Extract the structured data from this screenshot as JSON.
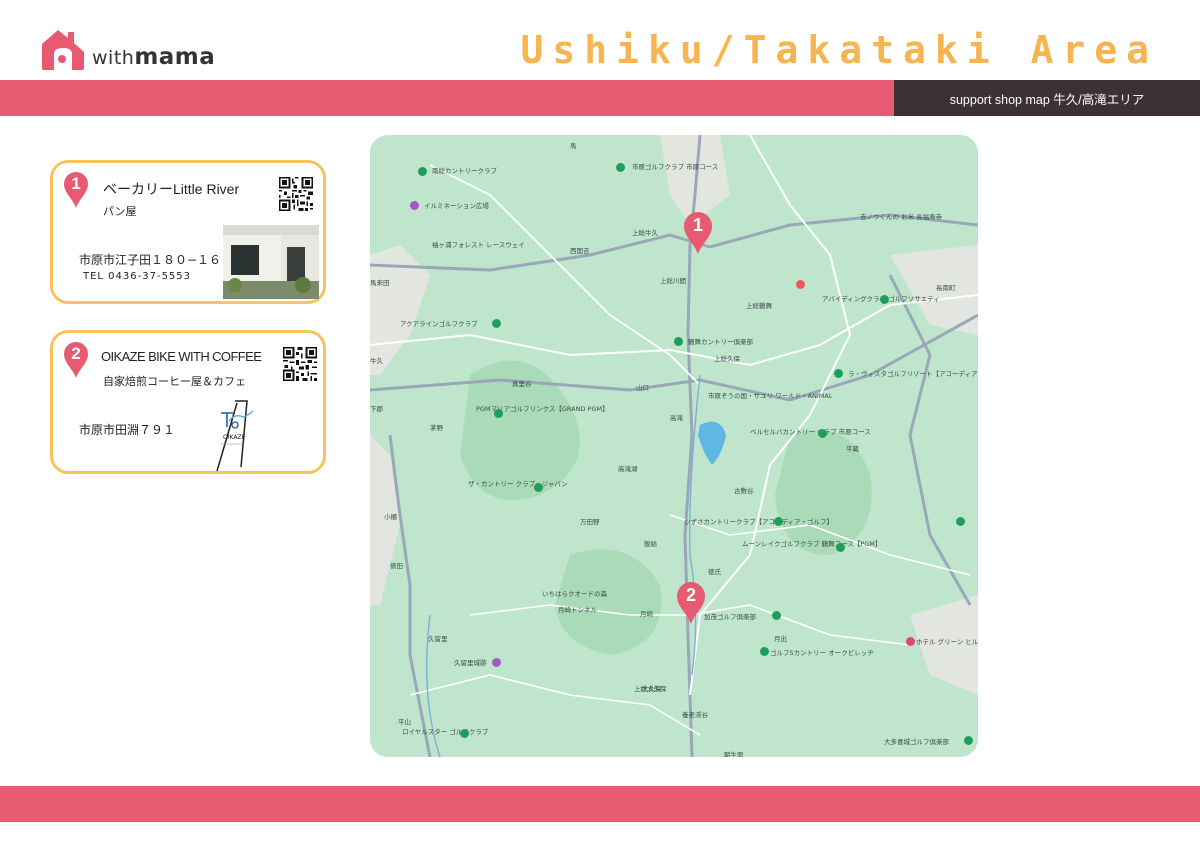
{
  "brand": {
    "logo_with": "with",
    "logo_mama": "mama"
  },
  "header": {
    "area_title": "Ushiku/Takataki  Area",
    "subtitle": "support shop map 牛久/高滝エリア"
  },
  "colors": {
    "accent_pink": "#e85a71",
    "accent_orange": "#f7b451",
    "dark": "#3c3233",
    "card_border": "#f6c35e"
  },
  "shops": [
    {
      "number": "1",
      "name": "ベーカリーLittle River",
      "type": "パン屋",
      "address": "市原市江子田１８０−１６",
      "tel": "TEL 0436-37-5553",
      "has_qr": true,
      "image": "shop-photo"
    },
    {
      "number": "2",
      "name": "OIKAZE BIKE WITH COFFEE",
      "type": "自家焙煎コーヒー屋＆カフェ",
      "address": "市原市田淵７９１",
      "has_qr": true,
      "image": "oikaze-logo",
      "logo_text": "OIKAZE"
    }
  ],
  "map": {
    "markers": [
      {
        "number": "1"
      },
      {
        "number": "2"
      }
    ],
    "labels": [
      "南総カントリークラブ",
      "市原ゴルフクラブ 市原コース",
      "イルミネーション広場",
      "袖ヶ浦フォレスト レースウェイ",
      "アクアラインゴルフクラブ",
      "PGMマリアゴルフリンクス【GRAND PGM】",
      "ザ・カントリー クラブ・ジャパン",
      "鶴舞カントリー倶楽部",
      "上総久保",
      "アバイディングクラブ ゴルフソサエティ",
      "長南町",
      "吉ノウくんの お米 長福寿寺",
      "ラ・ヴィスタゴルフリゾート【アコーディア・ゴルフ】",
      "ベルセルバカントリー クラブ 市原コース",
      "かずさカントリークラブ【アコーディア・ゴルフ】",
      "ムーンレイクゴルフクラブ 鶴舞コース【PGM】",
      "いちはらクオードの森",
      "月崎トンネル",
      "加茂ゴルフ倶楽部",
      "ゴルフ5カントリー オークビレッヂ",
      "ホテル グリーン ヒル 大多喜",
      "久留里城跡",
      "ロイヤルスター ゴルフクラブ",
      "大多喜城ゴルフ倶楽部",
      "市原ぞうの国・サユリ ワールド・ANIMAL",
      "西国吉",
      "上総牛久",
      "上総川間",
      "上総鶴舞",
      "高滝",
      "高滝湖",
      "牛久",
      "山口",
      "真里谷",
      "茅野",
      "万田野",
      "飯給",
      "月崎",
      "上総大久保",
      "養老渓谷",
      "朝生原",
      "古敷谷",
      "平蔵",
      "月出",
      "徳氏",
      "久留里",
      "平山",
      "小櫃",
      "俵田",
      "馬来田",
      "下郡",
      "馬",
      "大久保"
    ]
  }
}
